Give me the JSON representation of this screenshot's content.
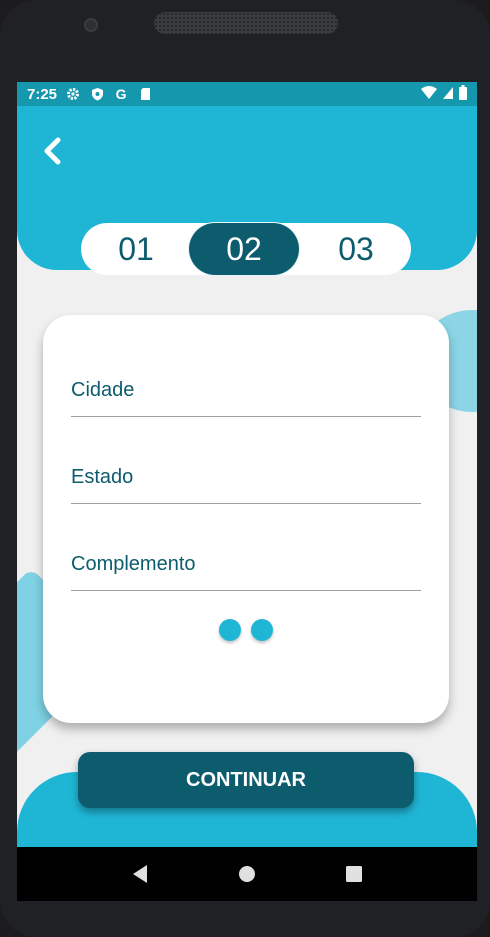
{
  "status_bar": {
    "time": "7:25",
    "left_icons": [
      "gear-icon",
      "shield-icon",
      "google-icon",
      "sd-card-icon"
    ],
    "right_icons": [
      "wifi-icon",
      "signal-icon",
      "battery-icon"
    ],
    "google_glyph": "G"
  },
  "header": {
    "back_icon": "chevron-left-icon"
  },
  "stepper": {
    "steps": [
      "01",
      "02",
      "03"
    ],
    "active_index": 1
  },
  "form": {
    "fields": [
      {
        "label": "Cidade",
        "value": ""
      },
      {
        "label": "Estado",
        "value": ""
      },
      {
        "label": "Complemento",
        "value": ""
      }
    ],
    "page_dots": 2
  },
  "actions": {
    "continue_label": "CONTINUAR"
  },
  "nav_bar": {
    "buttons": [
      "back-triangle-icon",
      "home-circle-icon",
      "recents-square-icon"
    ]
  },
  "colors": {
    "primary_cyan": "#1fb6d6",
    "dark_teal": "#0d5c6e",
    "light_cyan": "#7fd2e4",
    "status_bar": "#1598ae"
  }
}
